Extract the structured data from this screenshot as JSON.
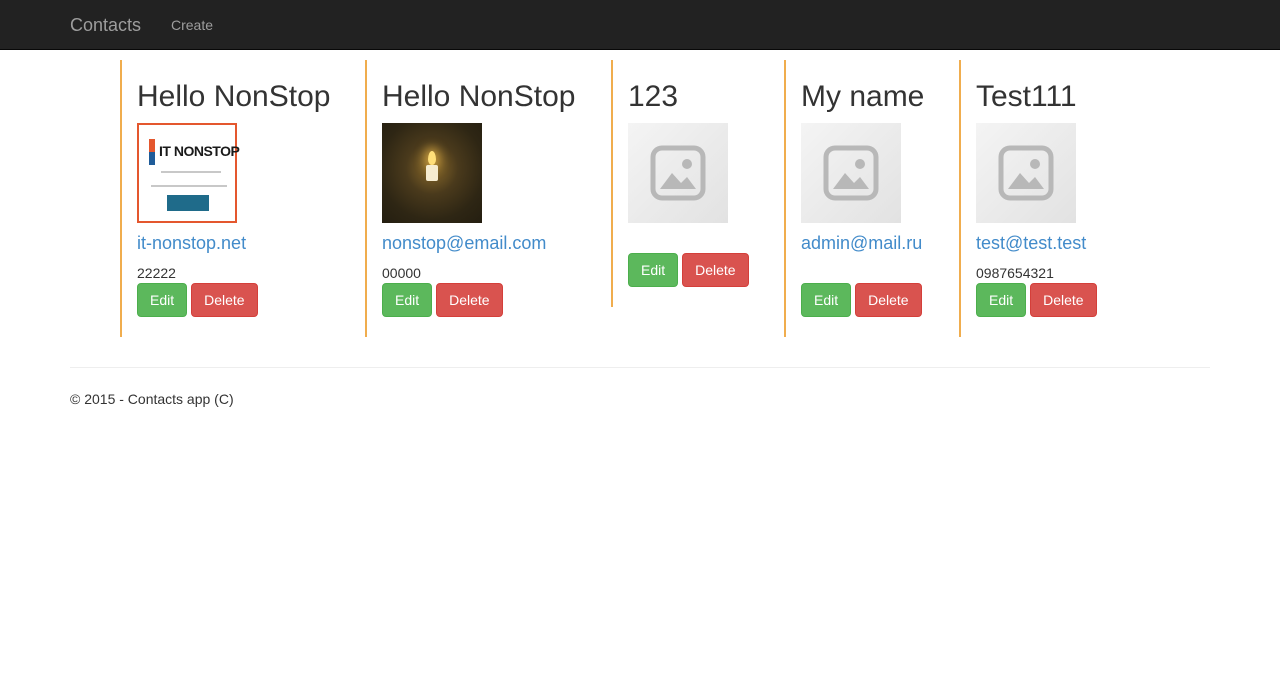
{
  "navbar": {
    "brand": "Contacts",
    "links": [
      {
        "label": "Create"
      }
    ],
    "background": "#222222"
  },
  "contacts": [
    {
      "name": "Hello NonStop",
      "image": "it-nonstop-logo",
      "image_text": "IT NONSTOP",
      "email": "it-nonstop.net",
      "phone": "22222",
      "edit_label": "Edit",
      "delete_label": "Delete"
    },
    {
      "name": "Hello NonStop",
      "image": "candle-photo",
      "email": "nonstop@email.com",
      "phone": "00000",
      "edit_label": "Edit",
      "delete_label": "Delete"
    },
    {
      "name": "123",
      "image": "placeholder-image-icon",
      "email": "",
      "phone": "",
      "edit_label": "Edit",
      "delete_label": "Delete"
    },
    {
      "name": "My name",
      "image": "placeholder-image-icon",
      "email": "admin@mail.ru",
      "phone": "",
      "edit_label": "Edit",
      "delete_label": "Delete"
    },
    {
      "name": "Test111",
      "image": "placeholder-image-icon",
      "email": "test@test.test",
      "phone": "0987654321",
      "edit_label": "Edit",
      "delete_label": "Delete"
    }
  ],
  "colors": {
    "card_border": "#f0ad4e",
    "link": "#428bca",
    "edit_button": "#5cb85c",
    "delete_button": "#d9534f"
  },
  "footer": {
    "text": "© 2015 - Contacts app (C)"
  }
}
